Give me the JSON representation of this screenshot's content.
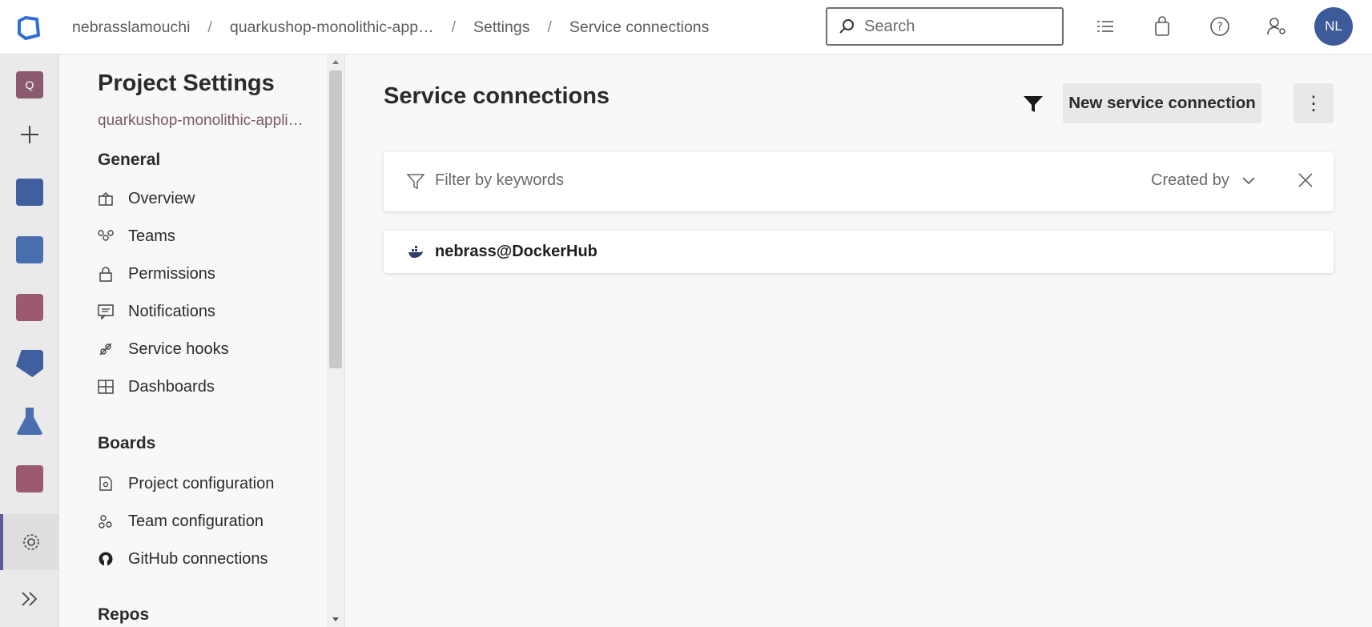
{
  "topbar": {
    "breadcrumbs": [
      "nebrasslamouchi",
      "quarkushop-monolithic-app…",
      "Settings",
      "Service connections"
    ],
    "search_placeholder": "Search",
    "avatar_initials": "NL"
  },
  "sidenav": {
    "title": "Project Settings",
    "project_name": "quarkushop-monolithic-appli…",
    "sections": [
      {
        "title": "General",
        "items": [
          "Overview",
          "Teams",
          "Permissions",
          "Notifications",
          "Service hooks",
          "Dashboards"
        ]
      },
      {
        "title": "Boards",
        "items": [
          "Project configuration",
          "Team configuration",
          "GitHub connections"
        ]
      },
      {
        "title": "Repos",
        "items": []
      }
    ]
  },
  "main": {
    "title": "Service connections",
    "new_button_label": "New service connection",
    "more_button_label": "⋮",
    "filter_placeholder": "Filter by keywords",
    "created_by_label": "Created by",
    "connections": [
      {
        "name": "nebrass@DockerHub",
        "icon": "docker-icon"
      }
    ]
  },
  "colors": {
    "accent": "#5b5b9b",
    "avatar": "#3d5a99",
    "rail_project": "#8b5a70"
  }
}
